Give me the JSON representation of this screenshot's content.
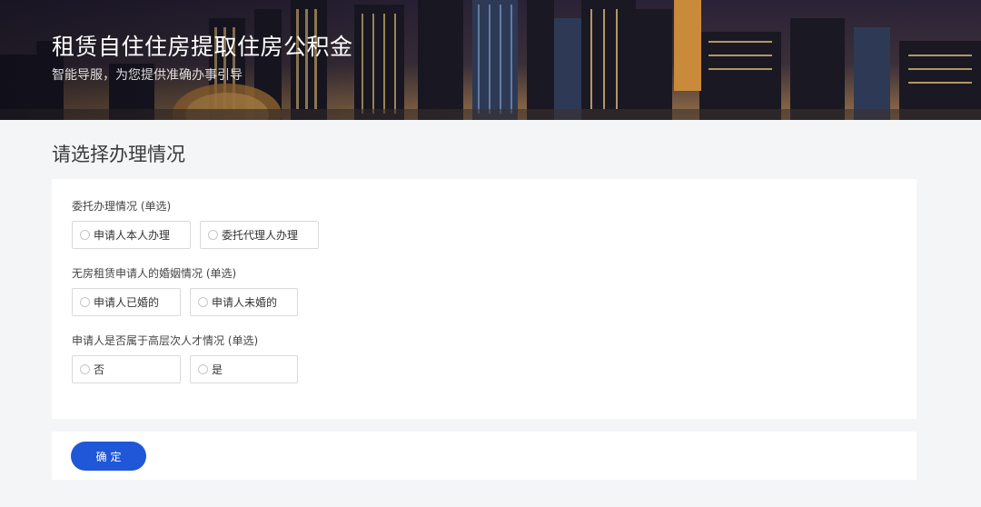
{
  "banner": {
    "title": "租赁自住住房提取住房公积金",
    "subtitle": "智能导服，为您提供准确办事引导"
  },
  "section_title": "请选择办理情况",
  "groups": [
    {
      "label": "委托办理情况 (单选)",
      "options": [
        "申请人本人办理",
        "委托代理人办理"
      ]
    },
    {
      "label": "无房租赁申请人的婚姻情况 (单选)",
      "options": [
        "申请人已婚的",
        "申请人未婚的"
      ]
    },
    {
      "label": "申请人是否属于高层次人才情况 (单选)",
      "options": [
        "否",
        "是"
      ]
    }
  ],
  "confirm_label": "确定",
  "colors": {
    "primary": "#1f57d8",
    "background": "#f4f5f7",
    "card": "#ffffff",
    "border": "#d9d9d9"
  },
  "icons": {
    "radio": "radio-unchecked-icon"
  }
}
